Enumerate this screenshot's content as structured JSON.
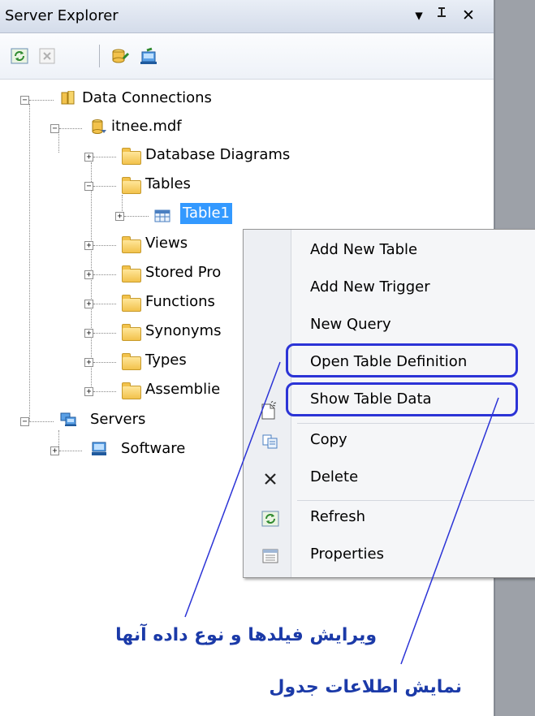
{
  "window": {
    "title": "Server Explorer",
    "controls": {
      "dropdown": "▾",
      "pin": "ᴵ",
      "close": "✕"
    }
  },
  "toolbar": {
    "buttons": [
      {
        "name": "refresh-icon"
      },
      {
        "name": "stop-icon"
      },
      {
        "name": "connect-to-database-icon"
      },
      {
        "name": "connect-to-server-icon"
      }
    ]
  },
  "tree": {
    "data_connections": "Data Connections",
    "database_file": "itnee.mdf",
    "database_diagrams": "Database Diagrams",
    "tables": "Tables",
    "table1": "Table1",
    "views": "Views",
    "stored_procedures": "Stored Pro",
    "functions": "Functions",
    "synonyms": "Synonyms",
    "types": "Types",
    "assemblies": "Assemblie",
    "servers": "Servers",
    "software": "Software"
  },
  "context_menu": {
    "add_new_table": "Add New Table",
    "add_new_trigger": "Add New Trigger",
    "new_query": "New Query",
    "open_table_definition": "Open Table Definition",
    "show_table_data": "Show Table Data",
    "copy": "Copy",
    "delete": "Delete",
    "refresh": "Refresh",
    "properties": "Properties"
  },
  "annotations": {
    "edit_fields": "ویرایش فیلدها و نوع داده آنها",
    "show_table_info": "نمایش اطلاعات جدول"
  },
  "colors": {
    "selection": "#3399ff",
    "highlight_border": "#2b33d6",
    "annotation_text": "#1b3aa8"
  }
}
